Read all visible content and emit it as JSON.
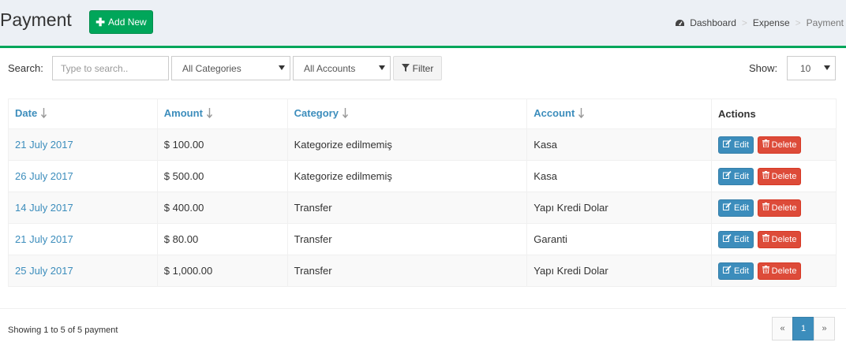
{
  "header": {
    "title": "Payment",
    "add_button_label": "Add New",
    "breadcrumb": [
      "Dashboard",
      "Expense",
      "Payment"
    ]
  },
  "toolbar": {
    "search_label": "Search:",
    "search_placeholder": "Type to search..",
    "category_select": "All Categories",
    "account_select": "All Accounts",
    "filter_label": "Filter",
    "show_label": "Show:",
    "show_value": "10"
  },
  "table": {
    "columns": [
      "Date",
      "Amount",
      "Category",
      "Account",
      "Actions"
    ],
    "rows": [
      {
        "date": "21 July 2017",
        "amount": "$ 100.00",
        "category": "Kategorize edilmemiş",
        "account": "Kasa"
      },
      {
        "date": "26 July 2017",
        "amount": "$ 500.00",
        "category": "Kategorize edilmemiş",
        "account": "Kasa"
      },
      {
        "date": "14 July 2017",
        "amount": "$ 400.00",
        "category": "Transfer",
        "account": "Yapı Kredi Dolar"
      },
      {
        "date": "21 July 2017",
        "amount": "$ 80.00",
        "category": "Transfer",
        "account": "Garanti"
      },
      {
        "date": "25 July 2017",
        "amount": "$ 1,000.00",
        "category": "Transfer",
        "account": "Yapı Kredi Dolar"
      }
    ],
    "edit_label": "Edit",
    "delete_label": "Delete"
  },
  "footer": {
    "showing_text": "Showing 1 to 5 of 5 payment",
    "pagination": [
      "«",
      "1",
      "»"
    ],
    "current_page": "1"
  },
  "colors": {
    "accent_green": "#00a65a",
    "link_blue": "#3c8dbc",
    "danger_red": "#dd4b39",
    "background": "#ecf0f5"
  },
  "icons": {
    "add": "plus-icon",
    "breadcrumb_home": "dashboard-icon",
    "filter": "filter-icon",
    "sort": "sort-arrow-icon",
    "edit": "edit-icon",
    "delete": "trash-icon"
  }
}
